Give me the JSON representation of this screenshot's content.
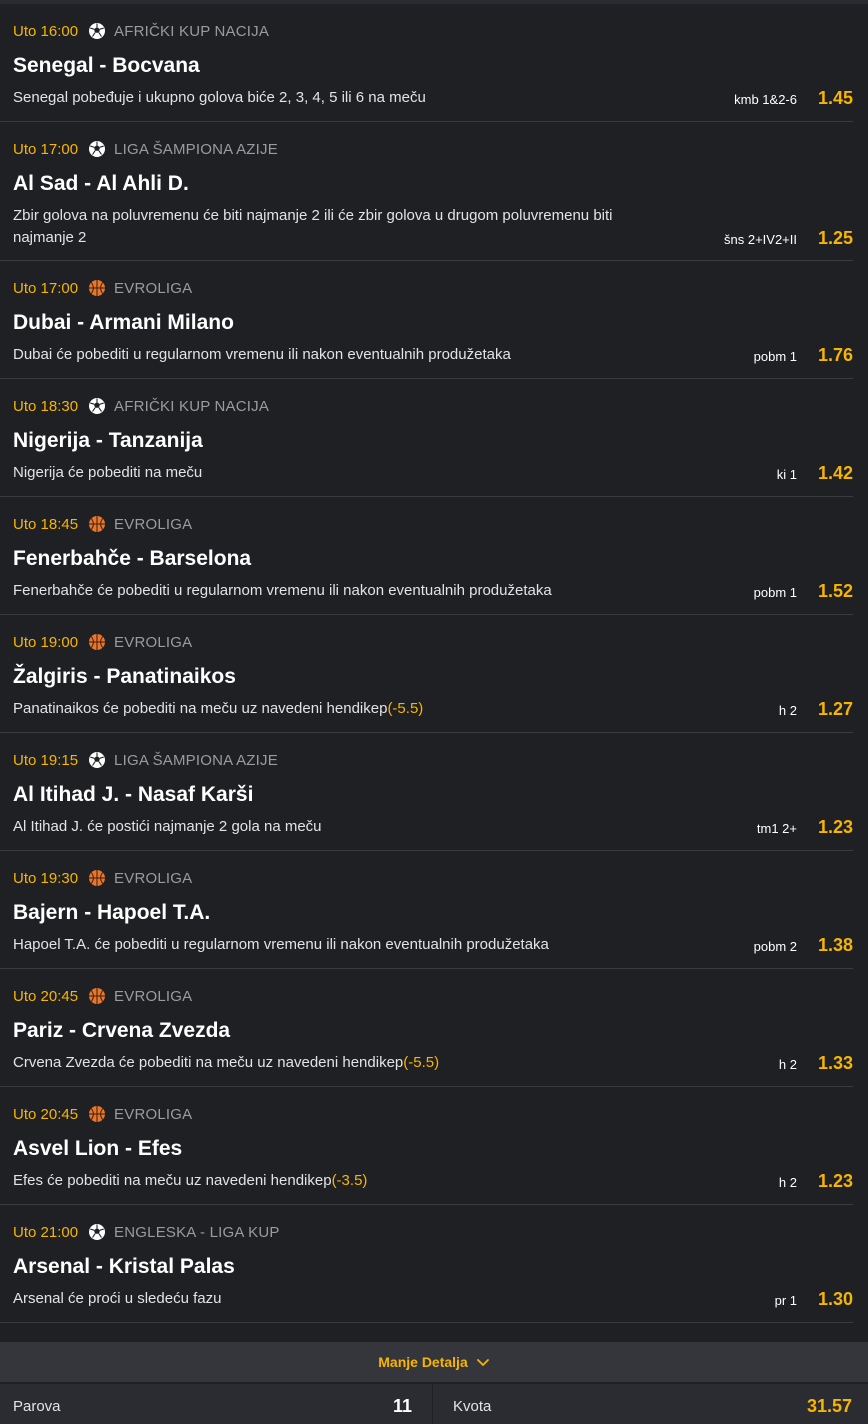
{
  "events": [
    {
      "time": "Uto 16:00",
      "sport": "soccer",
      "league": "AFRIČKI KUP NACIJA",
      "teams": "Senegal - Bocvana",
      "desc": "Senegal pobeđuje i ukupno golova biće 2, 3, 4, 5 ili 6 na meču",
      "hcp": "",
      "code": "kmb 1&2-6",
      "odd": "1.45"
    },
    {
      "time": "Uto 17:00",
      "sport": "soccer",
      "league": "LIGA ŠAMPIONA AZIJE",
      "teams": "Al Sad - Al Ahli D.",
      "desc": "Zbir golova na poluvremenu će biti najmanje 2 ili će zbir golova u drugom poluvremenu biti najmanje 2",
      "hcp": "",
      "code": "šns 2+IV2+II",
      "odd": "1.25"
    },
    {
      "time": "Uto 17:00",
      "sport": "basketball",
      "league": "EVROLIGA",
      "teams": "Dubai - Armani Milano",
      "desc": "Dubai će pobediti u regularnom vremenu ili nakon eventualnih produžetaka",
      "hcp": "",
      "code": "pobm 1",
      "odd": "1.76"
    },
    {
      "time": "Uto 18:30",
      "sport": "soccer",
      "league": "AFRIČKI KUP NACIJA",
      "teams": "Nigerija - Tanzanija",
      "desc": "Nigerija će pobediti na meču",
      "hcp": "",
      "code": "ki 1",
      "odd": "1.42"
    },
    {
      "time": "Uto 18:45",
      "sport": "basketball",
      "league": "EVROLIGA",
      "teams": "Fenerbahče - Barselona",
      "desc": "Fenerbahče će pobediti u regularnom vremenu ili nakon eventualnih produžetaka",
      "hcp": "",
      "code": "pobm 1",
      "odd": "1.52"
    },
    {
      "time": "Uto 19:00",
      "sport": "basketball",
      "league": "EVROLIGA",
      "teams": "Žalgiris - Panatinaikos",
      "desc": "Panatinaikos će pobediti na meču uz navedeni hendikep",
      "hcp": "(-5.5)",
      "code": "h 2",
      "odd": "1.27"
    },
    {
      "time": "Uto 19:15",
      "sport": "soccer",
      "league": "LIGA ŠAMPIONA AZIJE",
      "teams": "Al Itihad J. - Nasaf Karši",
      "desc": "Al Itihad J. će postići najmanje 2 gola na meču",
      "hcp": "",
      "code": "tm1 2+",
      "odd": "1.23"
    },
    {
      "time": "Uto 19:30",
      "sport": "basketball",
      "league": "EVROLIGA",
      "teams": "Bajern - Hapoel T.A.",
      "desc": "Hapoel T.A. će pobediti u regularnom vremenu ili nakon eventualnih produžetaka",
      "hcp": "",
      "code": "pobm 2",
      "odd": "1.38"
    },
    {
      "time": "Uto 20:45",
      "sport": "basketball",
      "league": "EVROLIGA",
      "teams": "Pariz - Crvena Zvezda",
      "desc": "Crvena Zvezda će pobediti na meču uz navedeni hendikep",
      "hcp": "(-5.5)",
      "code": "h 2",
      "odd": "1.33"
    },
    {
      "time": "Uto 20:45",
      "sport": "basketball",
      "league": "EVROLIGA",
      "teams": "Asvel Lion - Efes",
      "desc": "Efes će pobediti na meču uz navedeni hendikep",
      "hcp": "(-3.5)",
      "code": "h 2",
      "odd": "1.23"
    },
    {
      "time": "Uto 21:00",
      "sport": "soccer",
      "league": "ENGLESKA - LIGA KUP",
      "teams": "Arsenal - Kristal Palas",
      "desc": "Arsenal će proći u sledeću fazu",
      "hcp": "",
      "code": "pr 1",
      "odd": "1.30"
    }
  ],
  "footer": {
    "toggle_label": "Manje Detalja",
    "toggle_icon": "chevron-down-icon"
  },
  "summary": {
    "pairs_label": "Parova",
    "pairs_value": "11",
    "odds_label": "Kvota",
    "odds_value": "31.57"
  },
  "colors": {
    "accent": "#f7b500",
    "background": "#1f2024",
    "muted": "#9a9ba0"
  }
}
